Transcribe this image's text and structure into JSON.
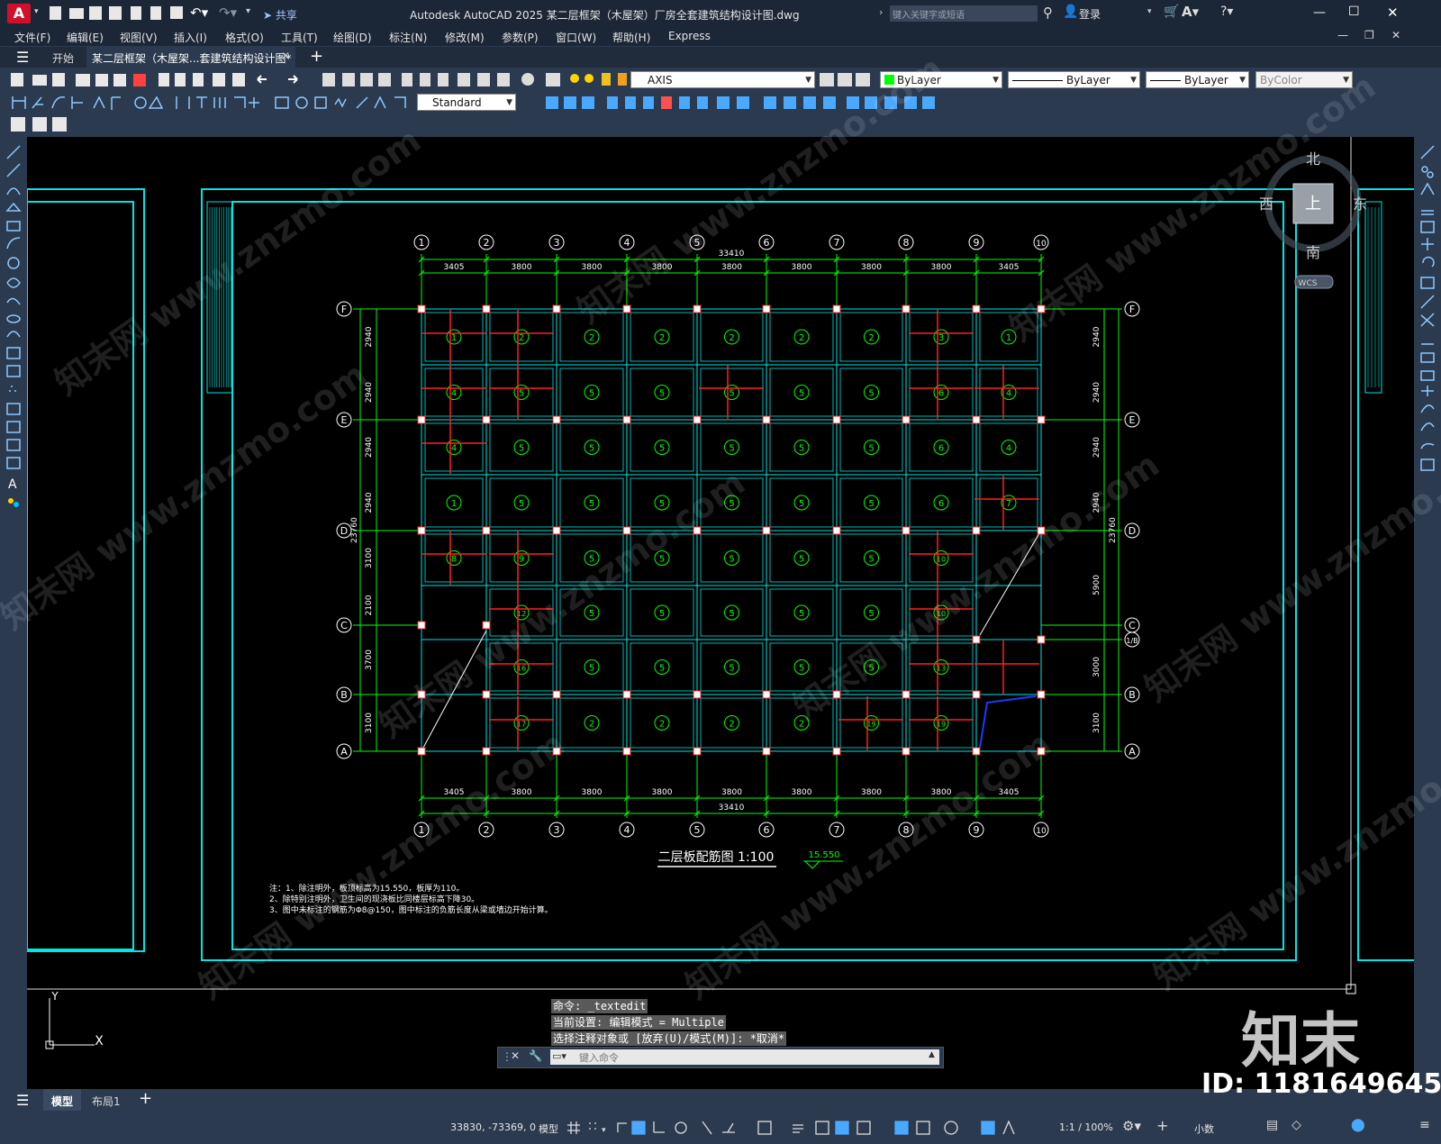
{
  "app": {
    "icon": "A",
    "title": "Autodesk AutoCAD 2025    某二层框架（木屋架）厂房全套建筑结构设计图.dwg",
    "share": "共享",
    "search_placeholder": "键入关键字或短语",
    "login": "登录"
  },
  "menu": [
    "文件(F)",
    "编辑(E)",
    "视图(V)",
    "插入(I)",
    "格式(O)",
    "工具(T)",
    "绘图(D)",
    "标注(N)",
    "修改(M)",
    "参数(P)",
    "窗口(W)",
    "帮助(H)",
    "Express"
  ],
  "tabs": {
    "start": "开始",
    "doc": "某二层框架（木屋架...套建筑结构设计图*"
  },
  "toolbar": {
    "layer": "AXIS",
    "color": "ByLayer",
    "linetype": "ByLayer",
    "lineweight": "ByLayer",
    "plotstyle": "ByColor",
    "textstyle": "Standard"
  },
  "viewcube": {
    "north": "北",
    "south": "南",
    "east": "东",
    "west": "西",
    "top": "上",
    "wcs": "WCS"
  },
  "drawing": {
    "title": "二层板配筋图  1:100",
    "elevation": "15.550",
    "axes_x": [
      "1",
      "2",
      "3",
      "4",
      "5",
      "6",
      "7",
      "8",
      "9",
      "10"
    ],
    "axes_y": [
      "A",
      "B",
      "C",
      "D",
      "E",
      "F"
    ],
    "axis_1b": "1/B",
    "dims_x": [
      "3405",
      "3800",
      "3800",
      "3800",
      "3800",
      "3800",
      "3800",
      "3800",
      "3405"
    ],
    "total_x": "33410",
    "dims_y_left": [
      "2940",
      "2940",
      "2940",
      "2940",
      "3100",
      "2100",
      "3700",
      "3100"
    ],
    "total_y": "23760",
    "dims_y_right": [
      "2940",
      "2940",
      "2940",
      "2940",
      "5900",
      "3000",
      "3100"
    ],
    "notes": [
      "注：1、除注明外，板顶标高为15.550，板厚为110。",
      "    2、除特别注明外，卫生间的现浇板比同楼层标高下降30。",
      "    3、图中未标注的钢筋为Φ8@150，图中标注的负筋长度从梁或墙边开始计算。"
    ],
    "slab_rows": [
      [
        "1",
        "2",
        "2",
        "2",
        "2",
        "2",
        "2",
        "3",
        "1"
      ],
      [
        "4",
        "5",
        "5",
        "5",
        "5",
        "5",
        "5",
        "6",
        "4"
      ],
      [
        "4",
        "5",
        "5",
        "5",
        "5",
        "5",
        "5",
        "6",
        "4"
      ],
      [
        "1",
        "5",
        "5",
        "5",
        "5",
        "5",
        "5",
        "6",
        "7"
      ],
      [
        "8",
        "9",
        "5",
        "5",
        "5",
        "5",
        "5",
        "10",
        ""
      ],
      [
        "",
        "12",
        "5",
        "5",
        "5",
        "5",
        "5",
        "10",
        ""
      ],
      [
        "",
        "16",
        "5",
        "5",
        "5",
        "5",
        "5",
        "13",
        ""
      ],
      [
        "",
        "17",
        "2",
        "2",
        "2",
        "2",
        "19",
        "19",
        ""
      ]
    ]
  },
  "command": {
    "lines": [
      "命令: _textedit",
      "当前设置: 编辑模式 = Multiple",
      "选择注释对象或 [放弃(U)/模式(M)]: *取消*"
    ],
    "placeholder": "键入命令"
  },
  "layouts": [
    "模型",
    "布局1"
  ],
  "status": {
    "coords": "33830, -73369, 0",
    "model": "模型",
    "scale": "1:1 / 100%",
    "units": "小数"
  },
  "watermark": {
    "logo": "知末",
    "id": "ID: 1181649645",
    "text": "知末网 www.znzmo.com"
  },
  "colors": {
    "cyan": "#00e5e5",
    "green": "#00ff00",
    "red": "#ff2020",
    "white": "#ffffff",
    "blue": "#1a3cff"
  }
}
